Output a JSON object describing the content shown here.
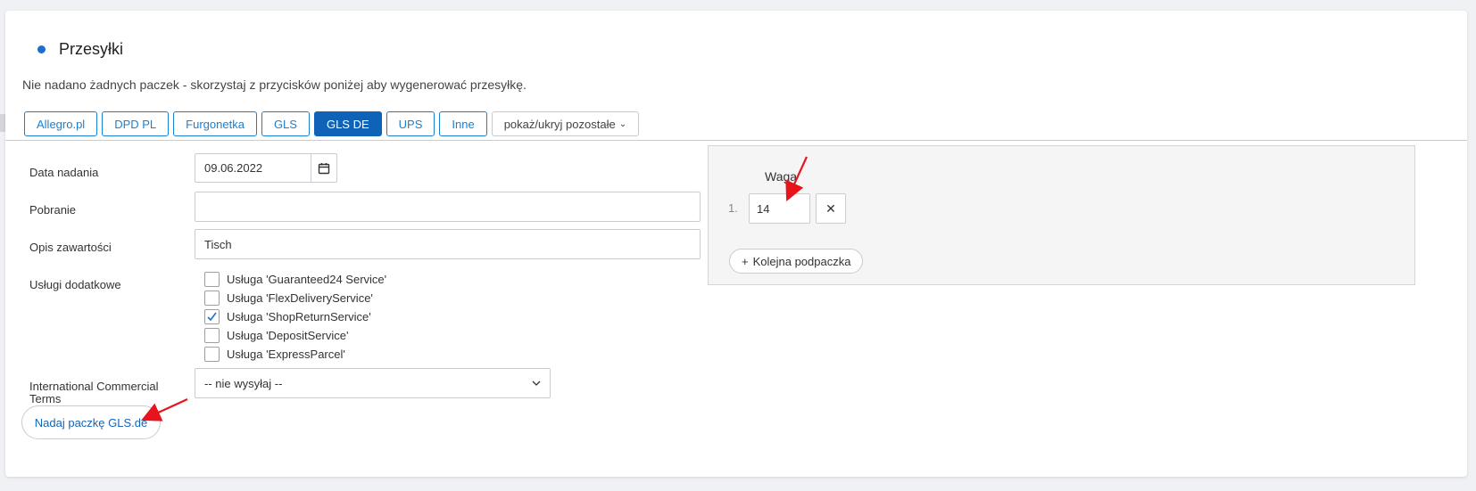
{
  "section": {
    "title": "Przesyłki",
    "notice": "Nie nadano żadnych paczek - skorzystaj z przycisków poniżej aby wygenerować przesyłkę."
  },
  "tabs": [
    {
      "label": "Allegro.pl",
      "active": false
    },
    {
      "label": "DPD PL",
      "active": false
    },
    {
      "label": "Furgonetka",
      "active": false
    },
    {
      "label": "GLS",
      "active": false
    },
    {
      "label": "GLS DE",
      "active": true
    },
    {
      "label": "UPS",
      "active": false
    },
    {
      "label": "Inne",
      "active": false
    }
  ],
  "toggle_more": "pokaż/ukryj pozostałe",
  "form": {
    "date_label": "Data nadania",
    "date_value": "09.06.2022",
    "cod_label": "Pobranie",
    "cod_value": "",
    "content_label": "Opis zawartości",
    "content_value": "Tisch",
    "services_label": "Usługi dodatkowe",
    "services": [
      {
        "label": "Usługa 'Guaranteed24 Service'",
        "checked": false
      },
      {
        "label": "Usługa 'FlexDeliveryService'",
        "checked": false
      },
      {
        "label": "Usługa 'ShopReturnService'",
        "checked": true
      },
      {
        "label": "Usługa 'DepositService'",
        "checked": false
      },
      {
        "label": "Usługa 'ExpressParcel'",
        "checked": false
      }
    ],
    "incoterms_label": "International Commercial Terms",
    "incoterms_value": "-- nie wysyłaj --"
  },
  "submit_label": "Nadaj paczkę GLS.de",
  "packages": {
    "weight_header": "Waga",
    "rows": [
      {
        "index": "1.",
        "weight": "14"
      }
    ],
    "remove_symbol": "✕",
    "add_label": "Kolejna podpaczka"
  },
  "colors": {
    "accent": "#0e63b8",
    "link": "#1b7fcf",
    "annotation": "#e8141c"
  }
}
